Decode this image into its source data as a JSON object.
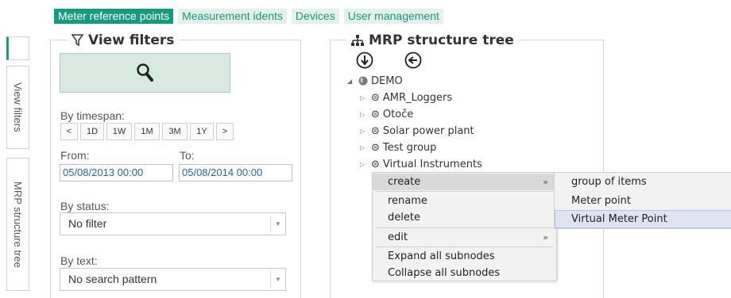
{
  "tabs": [
    {
      "label": "Meter reference points",
      "active": true
    },
    {
      "label": "Measurement idents",
      "active": false
    },
    {
      "label": "Devices",
      "active": false
    },
    {
      "label": "User management",
      "active": false
    }
  ],
  "side_tabs": {
    "view_filters": "View filters",
    "mrp_tree": "MRP structure tree"
  },
  "filters": {
    "title": "View filters",
    "by_timespan_label": "By timespan:",
    "timespan_buttons": [
      "<",
      "1D",
      "1W",
      "1M",
      "3M",
      "1Y",
      ">"
    ],
    "from_label": "From:",
    "to_label": "To:",
    "from_value": "05/08/2013 00:00",
    "to_value": "05/08/2014 00:00",
    "by_status_label": "By status:",
    "status_value": "No filter",
    "by_text_label": "By text:",
    "text_value": "No search pattern"
  },
  "tree": {
    "title": "MRP structure tree",
    "root": "DEMO",
    "nodes": [
      "AMR_Loggers",
      "Otoče",
      "Solar power plant",
      "Test group",
      "Virtual Instruments"
    ]
  },
  "context_menu": {
    "items": [
      {
        "label": "create",
        "submenu": "»"
      },
      {
        "label": "rename"
      },
      {
        "label": "delete"
      },
      {
        "label": "edit",
        "submenu": "»"
      },
      {
        "label": "Expand all subnodes"
      },
      {
        "label": "Collapse all subnodes"
      }
    ],
    "create_submenu": [
      "group of items",
      "Meter point",
      "Virtual Meter Point"
    ]
  },
  "colors": {
    "accent": "#169b7f",
    "tab_inactive_bg": "#e2f1ec",
    "date_text": "#2066a8",
    "menu_bg": "#f2f2f2"
  },
  "icons": {
    "filter": "funnel-icon",
    "search": "magnifier-icon",
    "tree": "hierarchy-icon",
    "collapse_all": "arrow-down-circle-icon",
    "back": "arrow-left-circle-icon",
    "root": "globe-icon",
    "node": "group-icon",
    "select": "chevron-down-icon"
  }
}
